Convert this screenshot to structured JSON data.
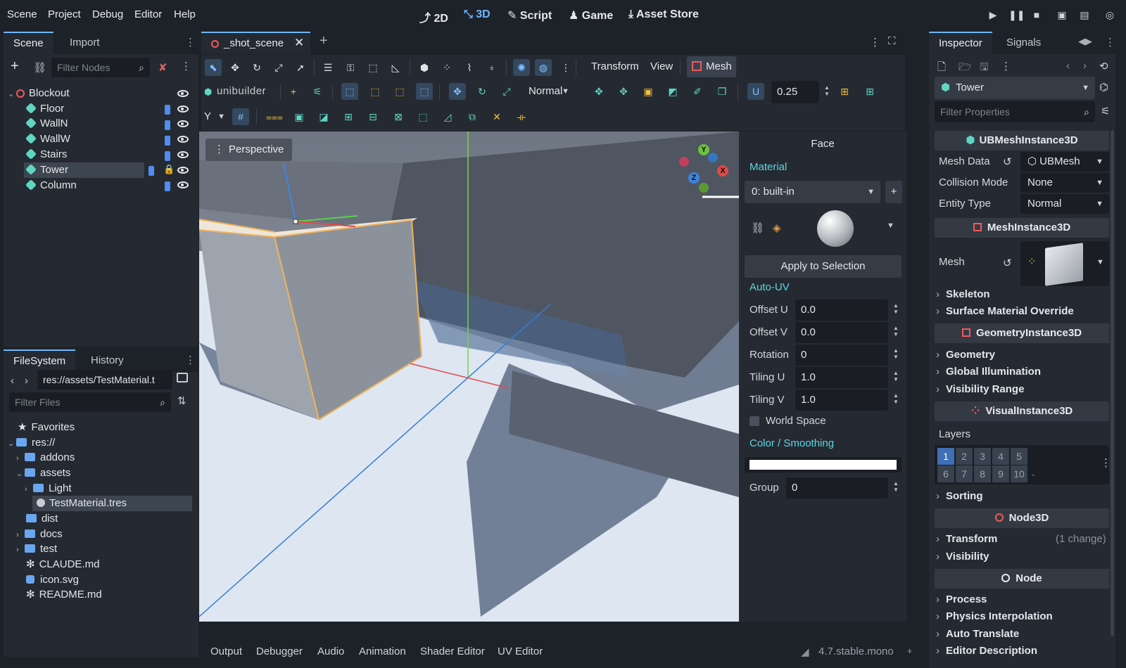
{
  "menus": [
    "Scene",
    "Project",
    "Debug",
    "Editor",
    "Help"
  ],
  "workspaces": [
    {
      "icon": "2d-icon",
      "label": "2D"
    },
    {
      "icon": "3d-icon",
      "label": "3D"
    },
    {
      "icon": "script-icon",
      "label": "Script"
    },
    {
      "icon": "game-icon",
      "label": "Game"
    },
    {
      "icon": "asset-store-icon",
      "label": "Asset Store"
    }
  ],
  "scene_dock": {
    "tabs": [
      "Scene",
      "Import"
    ],
    "filter_placeholder": "Filter Nodes",
    "nodes": [
      {
        "name": "Blockout",
        "type": "root"
      },
      {
        "name": "Floor",
        "type": "mesh"
      },
      {
        "name": "WallN",
        "type": "mesh"
      },
      {
        "name": "WallW",
        "type": "mesh"
      },
      {
        "name": "Stairs",
        "type": "mesh"
      },
      {
        "name": "Tower",
        "type": "mesh",
        "selected": true,
        "locked": true
      },
      {
        "name": "Column",
        "type": "mesh"
      }
    ]
  },
  "filesystem": {
    "tabs": [
      "FileSystem",
      "History"
    ],
    "path": "res://assets/TestMaterial.t",
    "filter_placeholder": "Filter Files",
    "items": [
      "Favorites",
      "res://",
      "addons",
      "assets",
      "Light",
      "TestMaterial.tres",
      "dist",
      "docs",
      "test",
      "CLAUDE.md",
      "icon.svg",
      "README.md"
    ]
  },
  "editor": {
    "scene_tab": "_shot_scene",
    "toolbar_menus": [
      "Transform",
      "View",
      "Mesh"
    ],
    "unibuilder_label": "unibuilder",
    "mode_select": "Normal",
    "snap_value": "0.25",
    "axis_select": "Y",
    "viewport_label": "Perspective",
    "gizmo_axes": [
      "Y",
      "X",
      "Z"
    ]
  },
  "face_panel": {
    "title": "Face",
    "material_section": "Material",
    "material_select": "0: built-in",
    "apply_button": "Apply to Selection",
    "auto_uv_section": "Auto-UV",
    "fields": [
      {
        "label": "Offset U",
        "value": "0.0"
      },
      {
        "label": "Offset V",
        "value": "0.0"
      },
      {
        "label": "Rotation",
        "value": "0"
      },
      {
        "label": "Tiling U",
        "value": "1.0"
      },
      {
        "label": "Tiling V",
        "value": "1.0"
      }
    ],
    "world_space_label": "World Space",
    "color_section": "Color / Smoothing",
    "group_label": "Group",
    "group_value": "0"
  },
  "inspector": {
    "tabs": [
      "Inspector",
      "Signals"
    ],
    "node_name": "Tower",
    "filter_placeholder": "Filter Properties",
    "ubmesh_header": "UBMeshInstance3D",
    "mesh_data_label": "Mesh Data",
    "mesh_data_value": "UBMesh",
    "collision_label": "Collision Mode",
    "collision_value": "None",
    "entity_label": "Entity Type",
    "entity_value": "Normal",
    "meshinstance_header": "MeshInstance3D",
    "mesh_label": "Mesh",
    "mesh_groups": [
      "Skeleton",
      "Surface Material Override"
    ],
    "geometry_header": "GeometryInstance3D",
    "geometry_groups": [
      "Geometry",
      "Global Illumination",
      "Visibility Range"
    ],
    "visual_header": "VisualInstance3D",
    "layers_label": "Layers",
    "layers": [
      "1",
      "2",
      "3",
      "4",
      "5",
      "6",
      "7",
      "8",
      "9",
      "10"
    ],
    "sorting_group": "Sorting",
    "node3d_header": "Node3D",
    "transform_group": "Transform",
    "transform_note": "(1 change)",
    "visibility_group": "Visibility",
    "node_header": "Node",
    "node_groups": [
      "Process",
      "Physics Interpolation",
      "Auto Translate",
      "Editor Description"
    ]
  },
  "bottom_tabs": [
    "Output",
    "Debugger",
    "Audio",
    "Animation",
    "Shader Editor",
    "UV Editor"
  ],
  "version": "4.7.stable.mono"
}
